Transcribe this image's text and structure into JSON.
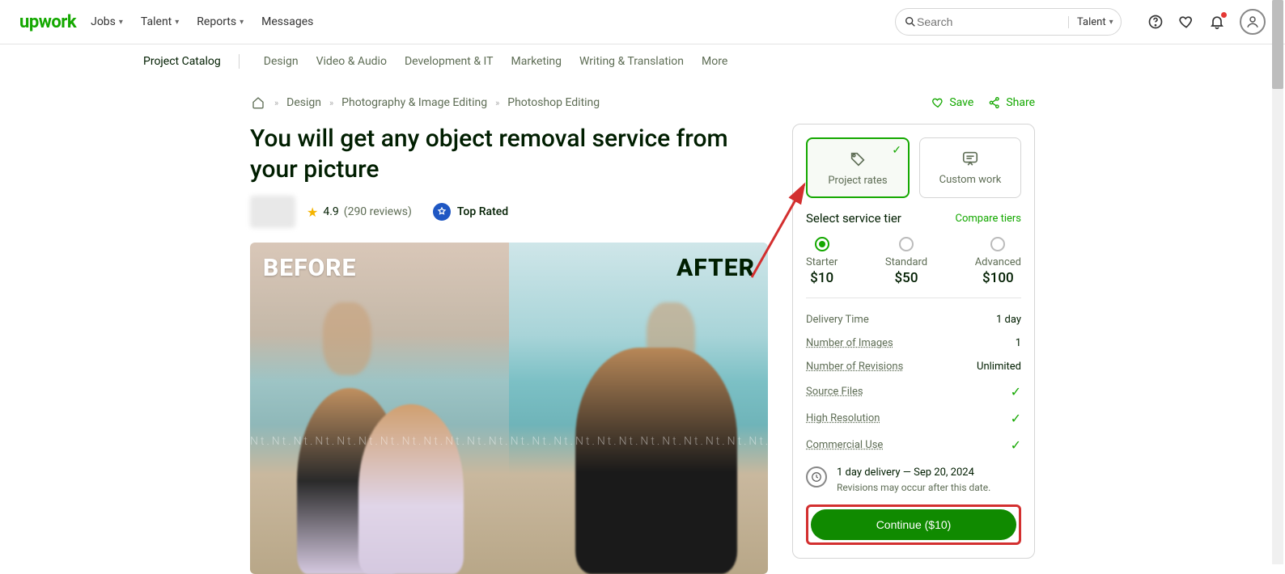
{
  "brand": "upwork",
  "topnav": {
    "jobs": "Jobs",
    "talent": "Talent",
    "reports": "Reports",
    "messages": "Messages"
  },
  "search": {
    "placeholder": "Search",
    "scope": "Talent"
  },
  "subnav": {
    "lead": "Project Catalog",
    "items": [
      "Design",
      "Video & Audio",
      "Development & IT",
      "Marketing",
      "Writing & Translation",
      "More"
    ]
  },
  "breadcrumb": {
    "items": [
      "Design",
      "Photography & Image Editing",
      "Photoshop Editing"
    ]
  },
  "actions": {
    "save": "Save",
    "share": "Share"
  },
  "project": {
    "title": "You will get any object removal service from your picture",
    "rating": "4.9",
    "reviews": "(290 reviews)",
    "top_rated": "Top Rated",
    "hero": {
      "before": "BEFORE",
      "after": "AFTER"
    }
  },
  "pricing": {
    "tab_rates": "Project rates",
    "tab_custom": "Custom work",
    "select_label": "Select service tier",
    "compare": "Compare tiers",
    "tiers": [
      {
        "name": "Starter",
        "price": "$10",
        "selected": true
      },
      {
        "name": "Standard",
        "price": "$50",
        "selected": false
      },
      {
        "name": "Advanced",
        "price": "$100",
        "selected": false
      }
    ],
    "features": {
      "delivery_time_k": "Delivery Time",
      "delivery_time_v": "1 day",
      "num_images_k": "Number of Images",
      "num_images_v": "1",
      "num_revisions_k": "Number of Revisions",
      "num_revisions_v": "Unlimited",
      "source_files_k": "Source Files",
      "high_res_k": "High Resolution",
      "commercial_k": "Commercial Use"
    },
    "delivery_line": "1 day delivery — Sep 20, 2024",
    "delivery_note": "Revisions may occur after this date.",
    "cta": "Continue ($10)"
  }
}
